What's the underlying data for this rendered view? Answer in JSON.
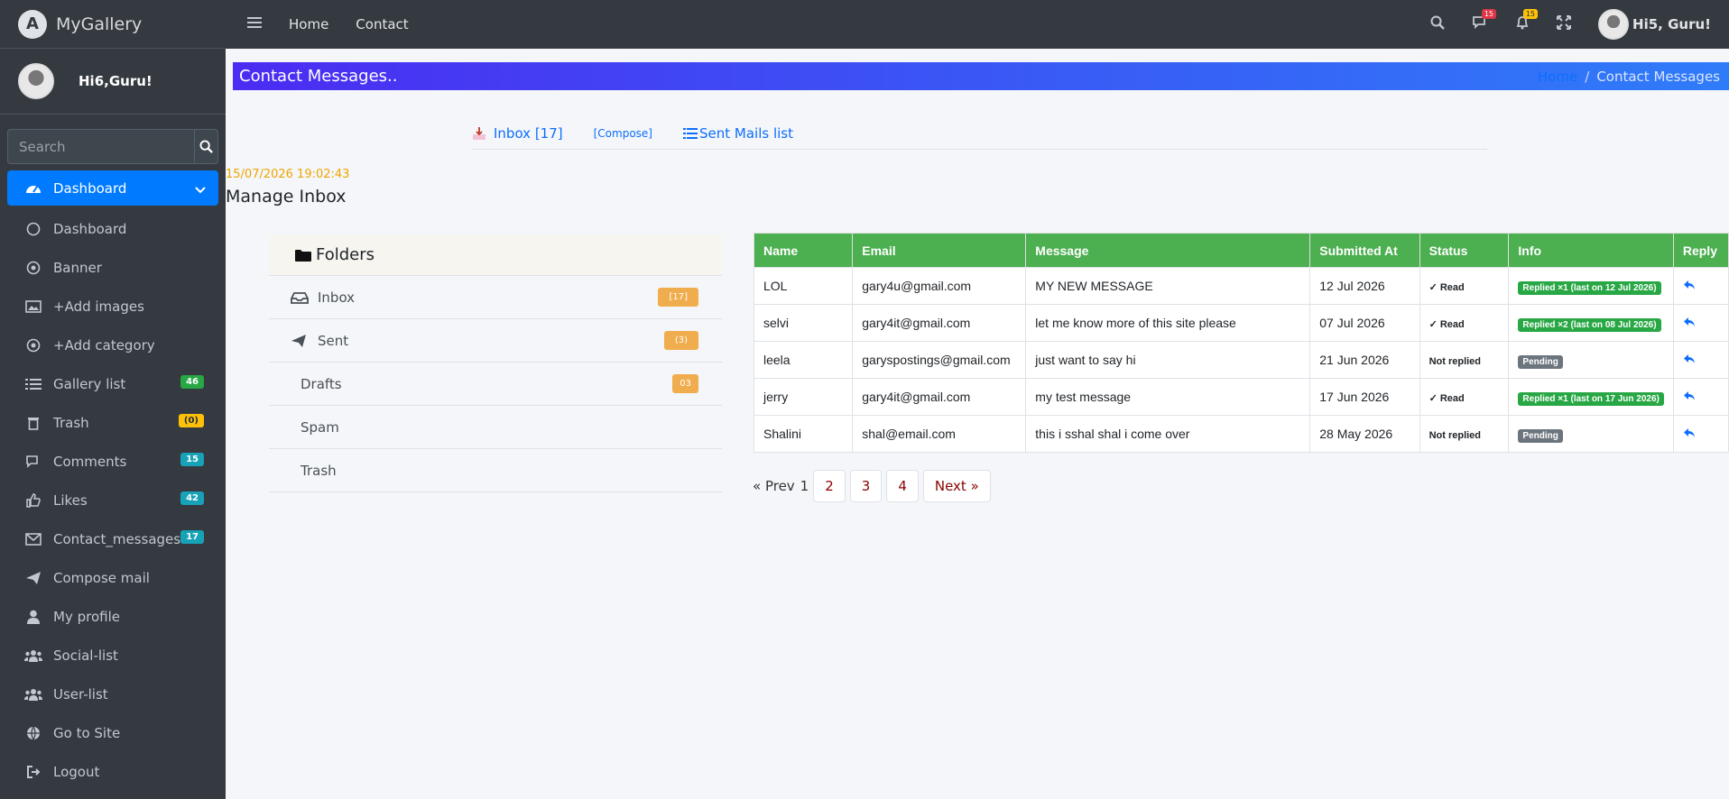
{
  "brand": {
    "name": "MyGallery"
  },
  "user_panel": {
    "name": "Hi6,Guru!"
  },
  "search": {
    "placeholder": "Search"
  },
  "sidebar": {
    "items": [
      {
        "label": "Dashboard",
        "icon": "tachometer-icon",
        "active": true
      },
      {
        "label": "Dashboard",
        "icon": "circle-icon"
      },
      {
        "label": "Banner",
        "icon": "dot-circle-icon"
      },
      {
        "label": "+Add images",
        "icon": "image-icon"
      },
      {
        "label": "+Add category",
        "icon": "dot-circle-icon"
      },
      {
        "label": "Gallery list",
        "icon": "list-icon",
        "badge": "46"
      },
      {
        "label": "Trash",
        "icon": "trash-icon",
        "badge": "(0)"
      },
      {
        "label": "Comments",
        "icon": "comments-icon",
        "badge": "15"
      },
      {
        "label": "Likes",
        "icon": "thumbs-up-icon",
        "badge": "42"
      },
      {
        "label": "Contact_messages",
        "icon": "envelope-icon",
        "badge": "17"
      },
      {
        "label": "Compose mail",
        "icon": "paper-plane-icon"
      },
      {
        "label": "My profile",
        "icon": "user-icon"
      },
      {
        "label": "Social-list",
        "icon": "users-icon"
      },
      {
        "label": "User-list",
        "icon": "users-icon"
      },
      {
        "label": "Go to Site",
        "icon": "globe-icon"
      },
      {
        "label": "Logout",
        "icon": "sign-out-icon"
      }
    ]
  },
  "topnav": {
    "links": [
      "Home",
      "Contact"
    ],
    "comments_count": "15",
    "notifications_count": "15",
    "user_greeting": "Hi5, Guru!"
  },
  "header": {
    "title": "Contact Messages..",
    "breadcrumb_home": "Home",
    "breadcrumb_sep": "/",
    "breadcrumb_current": "Contact Messages"
  },
  "mail_tabs": {
    "inbox": "Inbox [17]",
    "compose": "[Compose]",
    "sent": "Sent Mails list"
  },
  "timestamp": "15/07/2026 19:02:43",
  "section_title": "Manage Inbox",
  "folders": {
    "title": "Folders",
    "items": [
      {
        "label": "Inbox",
        "badge": "[17]"
      },
      {
        "label": "Sent",
        "badge": "(3)"
      },
      {
        "label": "Drafts",
        "badge": "03"
      },
      {
        "label": "Spam"
      },
      {
        "label": "Trash"
      }
    ]
  },
  "table": {
    "headers": [
      "Name",
      "Email",
      "Message",
      "Submitted At",
      "Status",
      "Info",
      "Reply"
    ],
    "rows": [
      {
        "name": "LOL",
        "email": "gary4u@gmail.com",
        "message": "MY NEW MESSAGE",
        "date": "12 Jul 2026",
        "status": "✓ Read",
        "info": "Replied ×1 (last on 12 Jul 2026)",
        "info_type": "replied"
      },
      {
        "name": "selvi",
        "email": "gary4it@gmail.com",
        "message": "let me know more of this site please",
        "date": "07 Jul 2026",
        "status": "✓ Read",
        "info": "Replied ×2 (last on 08 Jul 2026)",
        "info_type": "replied"
      },
      {
        "name": "leela",
        "email": "garyspostings@gmail.com",
        "message": "just want to say hi",
        "date": "21 Jun 2026",
        "status": "Not replied",
        "info": "Pending",
        "info_type": "pending"
      },
      {
        "name": "jerry",
        "email": "gary4it@gmail.com",
        "message": "my test message",
        "date": "17 Jun 2026",
        "status": "✓ Read",
        "info": "Replied ×1 (last on 17 Jun 2026)",
        "info_type": "replied"
      },
      {
        "name": "Shalini",
        "email": "shal@email.com",
        "message": "this i sshal shal i come over",
        "date": "28 May 2026",
        "status": "Not replied",
        "info": "Pending",
        "info_type": "pending"
      }
    ]
  },
  "pagination": {
    "prev": "« Prev",
    "current": "1",
    "pages": [
      "2",
      "3",
      "4"
    ],
    "next": "Next »"
  },
  "colors": {
    "accent": "#007bff",
    "table_header": "#4caf50",
    "sidebar_bg": "#343a40"
  }
}
